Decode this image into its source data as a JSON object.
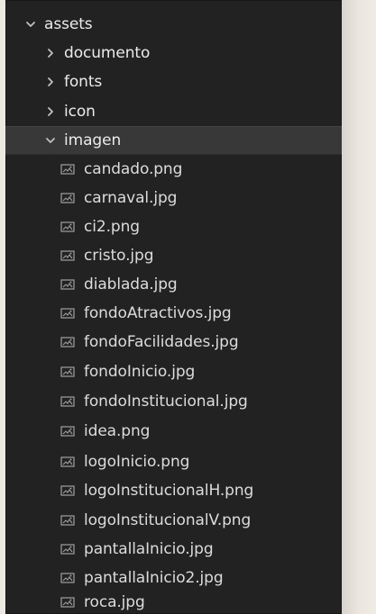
{
  "explorer": {
    "items": [
      {
        "label": "assets",
        "type": "folder",
        "expanded": true
      },
      {
        "label": "documento",
        "type": "folder",
        "expanded": false
      },
      {
        "label": "fonts",
        "type": "folder",
        "expanded": false
      },
      {
        "label": "icon",
        "type": "folder",
        "expanded": false
      },
      {
        "label": "imagen",
        "type": "folder",
        "expanded": true,
        "selected": true
      },
      {
        "label": "candado.png",
        "type": "file",
        "icon": "image-file-icon"
      },
      {
        "label": "carnaval.jpg",
        "type": "file",
        "icon": "image-file-icon"
      },
      {
        "label": "ci2.png",
        "type": "file",
        "icon": "image-file-icon"
      },
      {
        "label": "cristo.jpg",
        "type": "file",
        "icon": "image-file-icon"
      },
      {
        "label": "diablada.jpg",
        "type": "file",
        "icon": "image-file-icon"
      },
      {
        "label": "fondoAtractivos.jpg",
        "type": "file",
        "icon": "image-file-icon"
      },
      {
        "label": "fondoFacilidades.jpg",
        "type": "file",
        "icon": "image-file-icon"
      },
      {
        "label": "fondoInicio.jpg",
        "type": "file",
        "icon": "image-file-icon"
      },
      {
        "label": "fondoInstitucional.jpg",
        "type": "file",
        "icon": "image-file-icon"
      },
      {
        "label": "idea.png",
        "type": "file",
        "icon": "image-file-icon"
      },
      {
        "label": "logoInicio.png",
        "type": "file",
        "icon": "image-file-icon"
      },
      {
        "label": "logoInstitucionalH.png",
        "type": "file",
        "icon": "image-file-icon"
      },
      {
        "label": "logoInstitucionalV.png",
        "type": "file",
        "icon": "image-file-icon"
      },
      {
        "label": "pantallaInicio.jpg",
        "type": "file",
        "icon": "image-file-icon"
      },
      {
        "label": "pantallaInicio2.jpg",
        "type": "file",
        "icon": "image-file-icon"
      },
      {
        "label": "roca.jpg",
        "type": "file",
        "icon": "image-file-icon"
      }
    ],
    "colors": {
      "background": "#262626",
      "selected_background": "#3b3b3b",
      "text": "#d8d8d8",
      "chevron": "#bdbdbd"
    }
  }
}
